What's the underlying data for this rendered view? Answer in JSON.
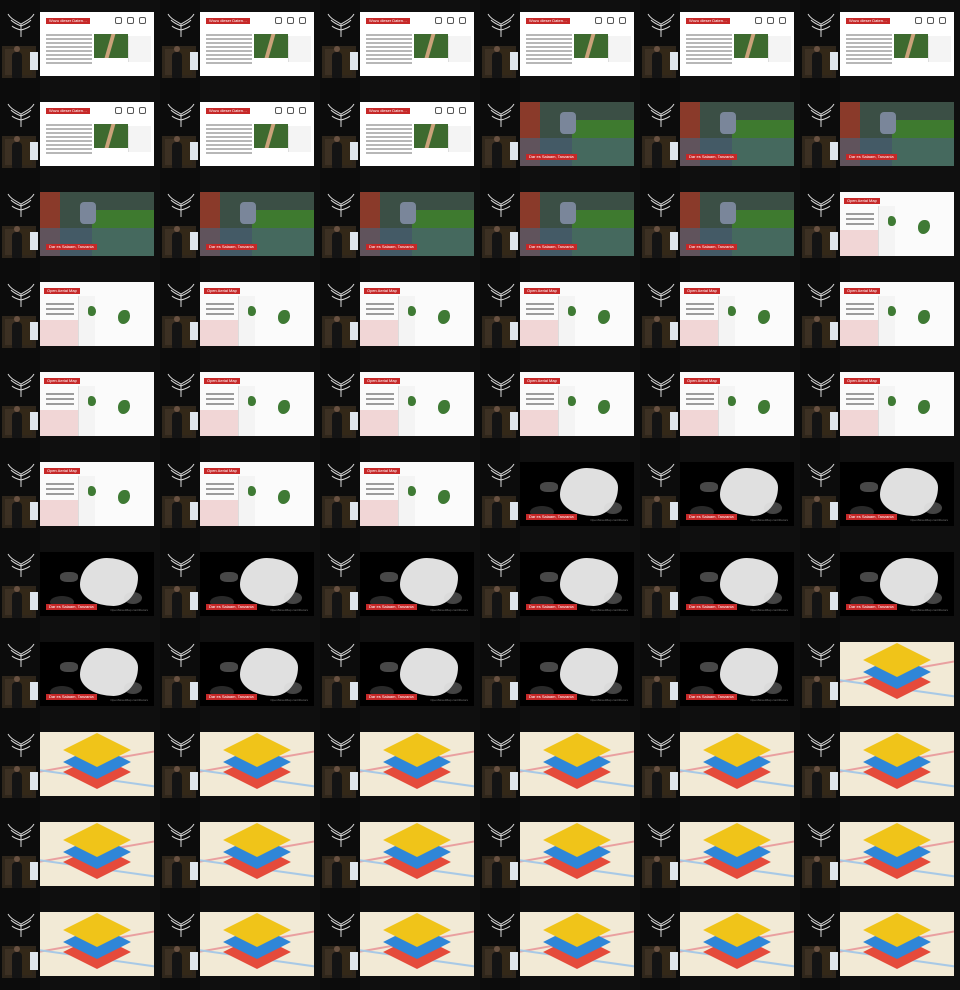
{
  "grid": {
    "columns": 6,
    "rows": 11
  },
  "labels": {
    "text_slide_title": "Wozu dieser Daten…",
    "open_aerial_title": "Open Aerial Map",
    "location_caption": "Dar es Salaam, Tanzania",
    "copyright": "OpenStreetMap contributors"
  },
  "cells": [
    [
      "text",
      "text",
      "text",
      "text",
      "text",
      "text"
    ],
    [
      "text",
      "text",
      "text",
      "photo",
      "photo",
      "photo"
    ],
    [
      "photo",
      "photo",
      "photo",
      "photo",
      "photo",
      "oam"
    ],
    [
      "oam",
      "oam",
      "oam",
      "oam",
      "oam",
      "oam"
    ],
    [
      "oam",
      "oam",
      "oam",
      "oam",
      "oam",
      "oam"
    ],
    [
      "oam",
      "oam",
      "oam",
      "dense",
      "dense",
      "dense"
    ],
    [
      "dense",
      "dense",
      "dense",
      "dense",
      "dense",
      "dense"
    ],
    [
      "dense",
      "dense",
      "dense",
      "dense",
      "dense",
      "layers"
    ],
    [
      "layers",
      "layers",
      "layers",
      "layers",
      "layers",
      "layers"
    ],
    [
      "layers",
      "layers",
      "layers",
      "layers",
      "layers",
      "layers"
    ],
    [
      "layers",
      "layers",
      "layers",
      "layers",
      "layers",
      "layers"
    ]
  ],
  "colors": {
    "background": "#0f0f0f",
    "accent_red": "#c62828",
    "layer_yellow": "#f0c419",
    "layer_blue": "#2f86d8",
    "layer_red": "#e54b3b"
  },
  "icons": {
    "layers": "layers-icon",
    "tree": "tree-logo-icon",
    "person": "speaker-icon"
  }
}
